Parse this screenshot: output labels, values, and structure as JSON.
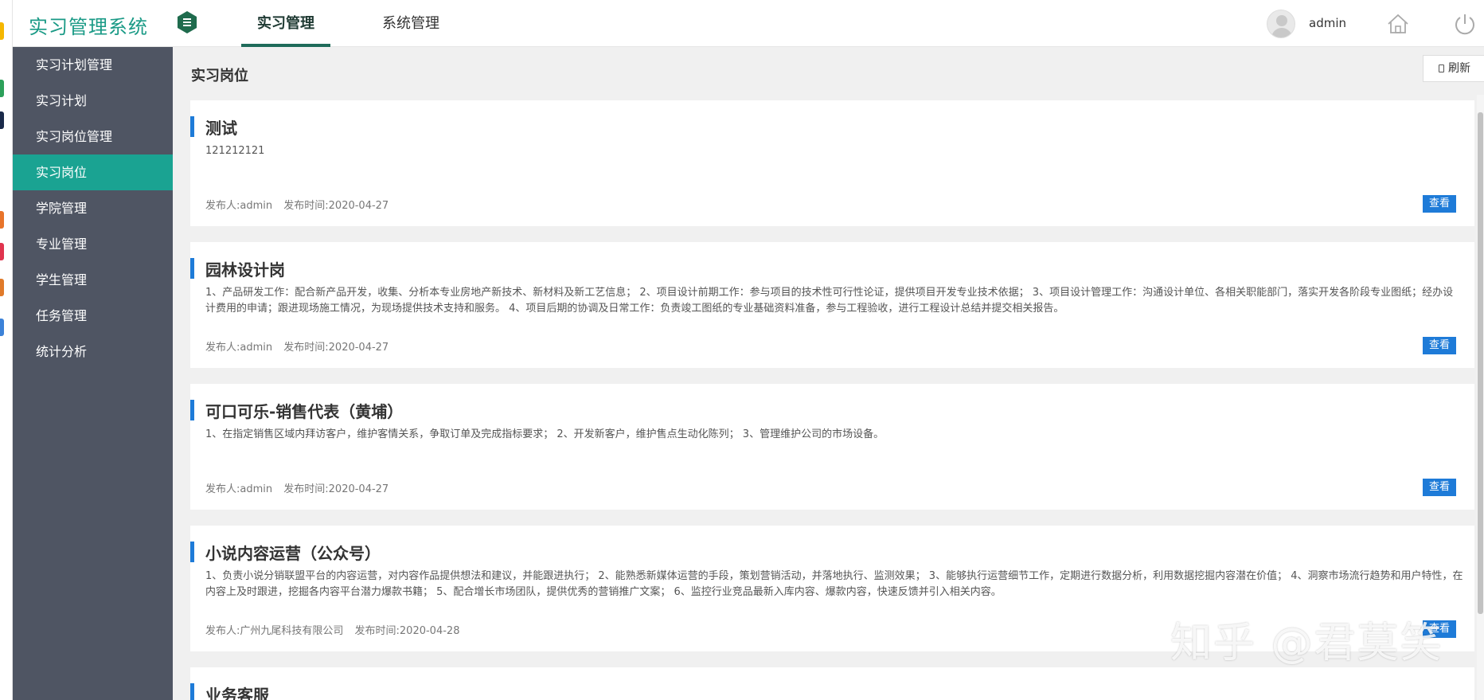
{
  "header": {
    "logo": "实习管理系统",
    "tabs": [
      {
        "label": "实习管理",
        "active": true
      },
      {
        "label": "系统管理",
        "active": false
      }
    ],
    "username": "admin"
  },
  "sidebar": {
    "items": [
      {
        "label": "实习计划管理",
        "active": false
      },
      {
        "label": "实习计划",
        "active": false
      },
      {
        "label": "实习岗位管理",
        "active": false
      },
      {
        "label": "实习岗位",
        "active": true
      },
      {
        "label": "学院管理",
        "active": false
      },
      {
        "label": "专业管理",
        "active": false
      },
      {
        "label": "学生管理",
        "active": false
      },
      {
        "label": "任务管理",
        "active": false
      },
      {
        "label": "统计分析",
        "active": false
      }
    ]
  },
  "main": {
    "title": "实习岗位",
    "refresh_label": "刷新",
    "view_label": "查看",
    "cards": [
      {
        "title": "测试",
        "desc": "121212121",
        "publisher": "发布人:admin",
        "time": "发布时间:2020-04-27"
      },
      {
        "title": "园林设计岗",
        "desc": "1、产品研发工作：配合新产品开发，收集、分析本专业房地产新技术、新材料及新工艺信息； 2、项目设计前期工作：参与项目的技术性可行性论证，提供项目开发专业技术依据； 3、项目设计管理工作：沟通设计单位、各相关职能部门，落实开发各阶段专业图纸；经办设计费用的申请；跟进现场施工情况，为现场提供技术支持和服务。 4、项目后期的协调及日常工作：负责竣工图纸的专业基础资料准备，参与工程验收，进行工程设计总结并提交相关报告。",
        "publisher": "发布人:admin",
        "time": "发布时间:2020-04-27"
      },
      {
        "title": "可口可乐-销售代表（黄埔）",
        "desc": "1、在指定销售区域内拜访客户，维护客情关系，争取订单及完成指标要求； 2、开发新客户，维护售点生动化陈列； 3、管理维护公司的市场设备。",
        "publisher": "发布人:admin",
        "time": "发布时间:2020-04-27"
      },
      {
        "title": "小说内容运营（公众号）",
        "desc": "1、负责小说分销联盟平台的内容运营，对内容作品提供想法和建议，并能跟进执行； 2、能熟悉新媒体运营的手段，策划营销活动，并落地执行、监测效果； 3、能够执行运营细节工作，定期进行数据分析，利用数据挖掘内容潜在价值； 4、洞察市场流行趋势和用户特性，在内容上及时跟进，挖掘各内容平台潜力爆款书籍； 5、配合增长市场团队，提供优秀的营销推广文案； 6、监控行业竞品最新入库内容、爆款内容，快速反馈并引入相关内容。",
        "publisher": "发布人:广州九尾科技有限公司",
        "time": "发布时间:2020-04-28"
      },
      {
        "title": "业务客服",
        "desc": "",
        "publisher": "",
        "time": ""
      }
    ]
  },
  "watermark": "知乎 @君莫笑",
  "colors": {
    "accent": "#1aa392",
    "sidebar_bg": "#4f5563",
    "button_blue": "#1e7bd8",
    "logo": "#1a9a86"
  }
}
